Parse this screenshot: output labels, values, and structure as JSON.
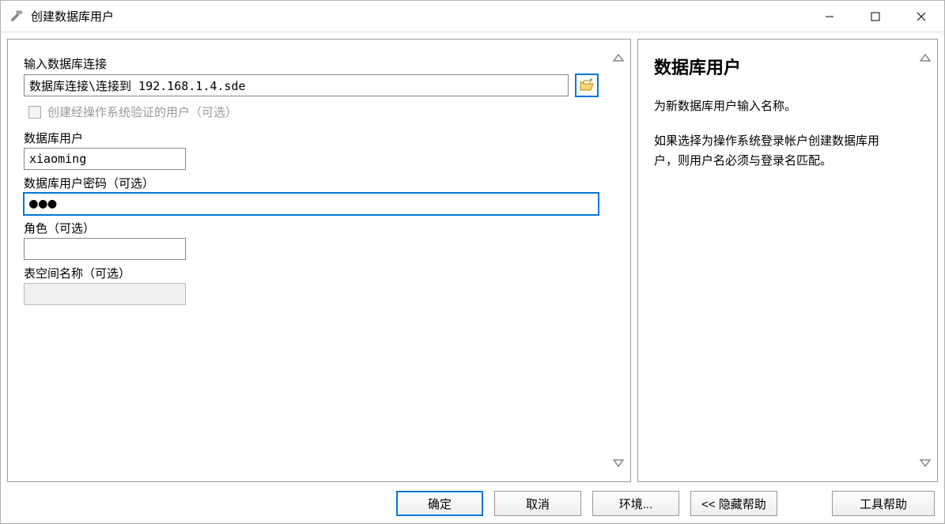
{
  "window": {
    "title": "创建数据库用户"
  },
  "form": {
    "connection_label": "输入数据库连接",
    "connection_value": "数据库连接\\连接到 192.168.1.4.sde",
    "os_auth_checkbox_label": "创建经操作系统验证的用户（可选）",
    "user_label": "数据库用户",
    "user_value": "xiaoming",
    "password_label": "数据库用户密码（可选）",
    "password_value": "●●●",
    "role_label": "角色（可选）",
    "role_value": "",
    "tablespace_label": "表空间名称（可选）",
    "tablespace_value": ""
  },
  "help": {
    "title": "数据库用户",
    "paragraph1": "为新数据库用户输入名称。",
    "paragraph2": "如果选择为操作系统登录帐户创建数据库用户，则用户名必须与登录名匹配。"
  },
  "buttons": {
    "ok": "确定",
    "cancel": "取消",
    "environments": "环境...",
    "hide_help": "<< 隐藏帮助",
    "tool_help": "工具帮助"
  }
}
